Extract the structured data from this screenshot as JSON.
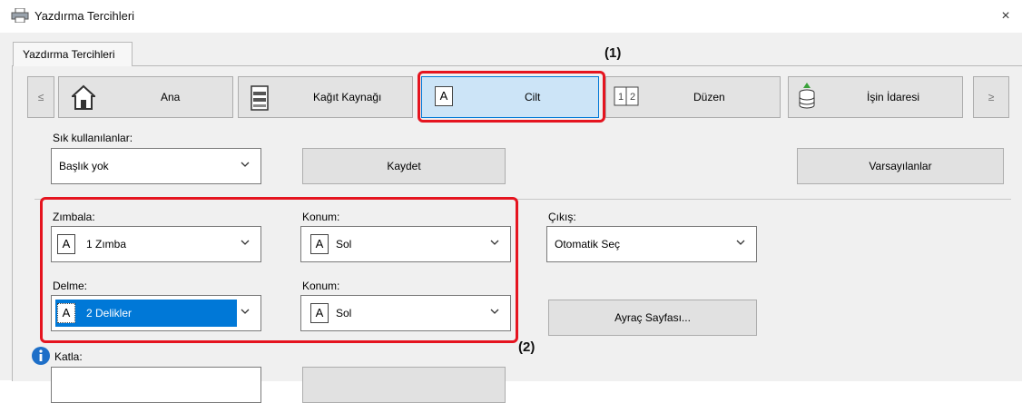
{
  "window": {
    "title": "Yazdırma Tercihleri",
    "close": "×"
  },
  "tab": {
    "label": "Yazdırma Tercihleri"
  },
  "nav": {
    "prev": "≤",
    "next": "≥",
    "items": [
      {
        "label": "Ana"
      },
      {
        "label": "Kağıt Kaynağı"
      },
      {
        "label": "Cilt"
      },
      {
        "label": "Düzen"
      },
      {
        "label": "İşin İdaresi"
      }
    ]
  },
  "favorites": {
    "label": "Sık kullanılanlar:",
    "value": "Başlık yok",
    "save": "Kaydet",
    "defaults": "Varsayılanlar"
  },
  "staple": {
    "label": "Zımbala:",
    "value": "1 Zımba",
    "position_label": "Konum:",
    "position_value": "Sol"
  },
  "punch": {
    "label": "Delme:",
    "value": "2 Delikler",
    "position_label": "Konum:",
    "position_value": "Sol"
  },
  "output": {
    "label": "Çıkış:",
    "value": "Otomatik Seç",
    "separator": "Ayraç Sayfası..."
  },
  "fold": {
    "label": "Katla:"
  },
  "callouts": {
    "one": "(1)",
    "two": "(2)"
  },
  "colors": {
    "highlight": "#e5141f",
    "selected": "#cce4f7",
    "accent": "#0078d7"
  }
}
